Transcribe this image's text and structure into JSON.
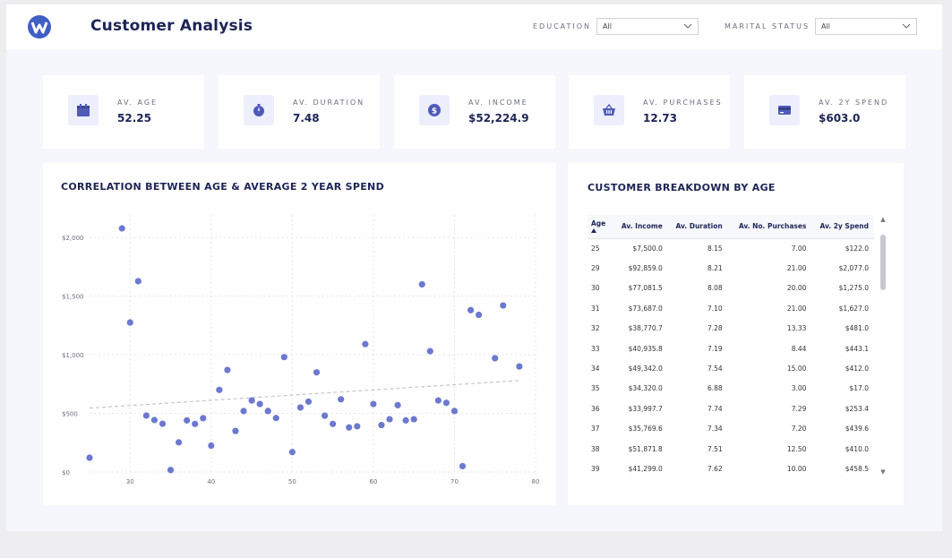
{
  "header": {
    "title": "Customer Analysis",
    "filters": [
      {
        "label": "EDUCATION",
        "value": "All"
      },
      {
        "label": "MARITAL STATUS",
        "value": "All"
      }
    ]
  },
  "kpis": [
    {
      "label": "AV. AGE",
      "value": "52.25",
      "icon": "calendar-icon"
    },
    {
      "label": "AV. DURATION",
      "value": "7.48",
      "icon": "stopwatch-icon"
    },
    {
      "label": "AV. INCOME",
      "value": "$52,224.9",
      "icon": "dollar-coin-icon"
    },
    {
      "label": "AV. PURCHASES",
      "value": "12.73",
      "icon": "basket-icon"
    },
    {
      "label": "AV. 2Y SPEND",
      "value": "$603.0",
      "icon": "credit-card-icon"
    }
  ],
  "scatter": {
    "title": "CORRELATION BETWEEN AGE & AVERAGE 2 YEAR SPEND"
  },
  "chart_data": {
    "type": "scatter",
    "title": "CORRELATION BETWEEN AGE & AVERAGE 2 YEAR SPEND",
    "xlim": [
      25,
      80
    ],
    "ylim": [
      0,
      2100
    ],
    "x_ticks": [
      30,
      40,
      50,
      60,
      70,
      80
    ],
    "y_ticks": [
      0,
      500,
      1000,
      1500,
      2000
    ],
    "y_tick_labels": [
      "$0",
      "$500",
      "$1,000",
      "$1,500",
      "$2,000"
    ],
    "grid": true,
    "point_color": "#6b79cf",
    "trendline": {
      "x": [
        25,
        78
      ],
      "y": [
        545,
        780
      ],
      "style": "dashed",
      "color": "#c4c6cf"
    },
    "points": [
      {
        "x": 25,
        "y": 122
      },
      {
        "x": 29,
        "y": 2077
      },
      {
        "x": 30,
        "y": 1275
      },
      {
        "x": 31,
        "y": 1627
      },
      {
        "x": 32,
        "y": 481
      },
      {
        "x": 33,
        "y": 443
      },
      {
        "x": 34,
        "y": 412
      },
      {
        "x": 35,
        "y": 17
      },
      {
        "x": 36,
        "y": 253
      },
      {
        "x": 37,
        "y": 440
      },
      {
        "x": 38,
        "y": 410
      },
      {
        "x": 39,
        "y": 459
      },
      {
        "x": 40,
        "y": 225
      },
      {
        "x": 41,
        "y": 700
      },
      {
        "x": 42,
        "y": 870
      },
      {
        "x": 43,
        "y": 350
      },
      {
        "x": 44,
        "y": 520
      },
      {
        "x": 45,
        "y": 610
      },
      {
        "x": 46,
        "y": 580
      },
      {
        "x": 47,
        "y": 520
      },
      {
        "x": 48,
        "y": 460
      },
      {
        "x": 49,
        "y": 980
      },
      {
        "x": 50,
        "y": 170
      },
      {
        "x": 51,
        "y": 550
      },
      {
        "x": 52,
        "y": 600
      },
      {
        "x": 53,
        "y": 850
      },
      {
        "x": 54,
        "y": 480
      },
      {
        "x": 55,
        "y": 410
      },
      {
        "x": 56,
        "y": 620
      },
      {
        "x": 57,
        "y": 380
      },
      {
        "x": 58,
        "y": 390
      },
      {
        "x": 59,
        "y": 1090
      },
      {
        "x": 60,
        "y": 580
      },
      {
        "x": 61,
        "y": 400
      },
      {
        "x": 62,
        "y": 450
      },
      {
        "x": 63,
        "y": 570
      },
      {
        "x": 64,
        "y": 440
      },
      {
        "x": 65,
        "y": 450
      },
      {
        "x": 66,
        "y": 1600
      },
      {
        "x": 67,
        "y": 1030
      },
      {
        "x": 68,
        "y": 610
      },
      {
        "x": 69,
        "y": 590
      },
      {
        "x": 70,
        "y": 520
      },
      {
        "x": 71,
        "y": 50
      },
      {
        "x": 72,
        "y": 1380
      },
      {
        "x": 73,
        "y": 1340
      },
      {
        "x": 75,
        "y": 970
      },
      {
        "x": 76,
        "y": 1420
      },
      {
        "x": 78,
        "y": 900
      }
    ]
  },
  "breakdown": {
    "title": "CUSTOMER BREAKDOWN BY AGE",
    "columns": [
      "Age",
      "Av. Income",
      "Av. Duration",
      "Av. No. Purchases",
      "Av. 2y Spend"
    ],
    "rows": [
      [
        "25",
        "$7,500.0",
        "8.15",
        "7.00",
        "$122.0"
      ],
      [
        "29",
        "$92,859.0",
        "8.21",
        "21.00",
        "$2,077.0"
      ],
      [
        "30",
        "$77,081.5",
        "8.08",
        "20.00",
        "$1,275.0"
      ],
      [
        "31",
        "$73,687.0",
        "7.10",
        "21.00",
        "$1,627.0"
      ],
      [
        "32",
        "$38,770.7",
        "7.28",
        "13.33",
        "$481.0"
      ],
      [
        "33",
        "$40,935.8",
        "7.19",
        "8.44",
        "$443.1"
      ],
      [
        "34",
        "$49,342.0",
        "7.54",
        "15.00",
        "$412.0"
      ],
      [
        "35",
        "$34,320.0",
        "6.88",
        "3.00",
        "$17.0"
      ],
      [
        "36",
        "$33,997.7",
        "7.74",
        "7.29",
        "$253.4"
      ],
      [
        "37",
        "$35,769.6",
        "7.34",
        "7.20",
        "$439.6"
      ],
      [
        "38",
        "$51,871.8",
        "7.51",
        "12.50",
        "$410.0"
      ],
      [
        "39",
        "$41,299.0",
        "7.62",
        "10.00",
        "$458.5"
      ]
    ]
  },
  "colors": {
    "accent": "#6b79cf",
    "title": "#1d2456",
    "icon_bg": "#edeffc"
  }
}
